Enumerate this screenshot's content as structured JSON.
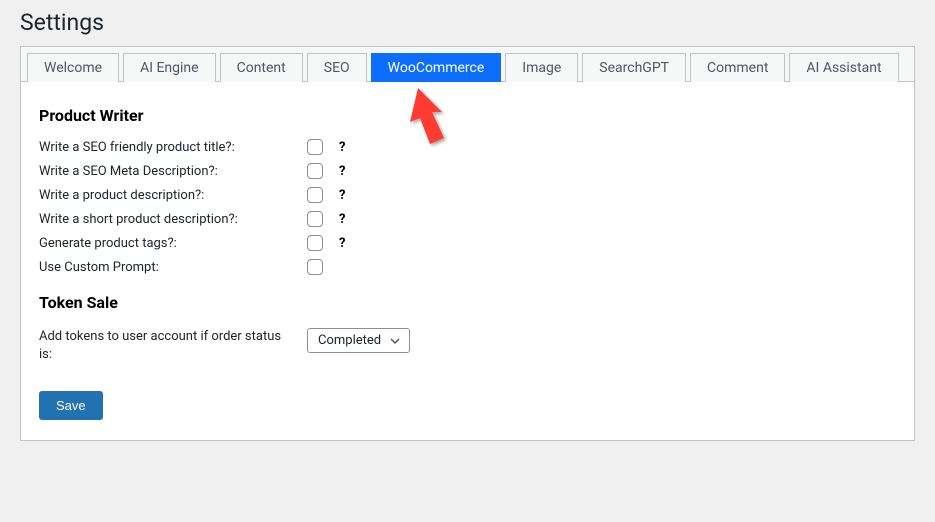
{
  "page": {
    "title": "Settings"
  },
  "tabs": [
    {
      "label": "Welcome",
      "active": false
    },
    {
      "label": "AI Engine",
      "active": false
    },
    {
      "label": "Content",
      "active": false
    },
    {
      "label": "SEO",
      "active": false
    },
    {
      "label": "WooCommerce",
      "active": true
    },
    {
      "label": "Image",
      "active": false
    },
    {
      "label": "SearchGPT",
      "active": false
    },
    {
      "label": "Comment",
      "active": false
    },
    {
      "label": "AI Assistant",
      "active": false
    }
  ],
  "sections": {
    "product_writer": {
      "heading": "Product Writer",
      "rows": [
        {
          "label": "Write a SEO friendly product title?:",
          "checked": false,
          "help": "?"
        },
        {
          "label": "Write a SEO Meta Description?:",
          "checked": false,
          "help": "?"
        },
        {
          "label": "Write a product description?:",
          "checked": false,
          "help": "?"
        },
        {
          "label": "Write a short product description?:",
          "checked": false,
          "help": "?"
        },
        {
          "label": "Generate product tags?:",
          "checked": false,
          "help": "?"
        },
        {
          "label": "Use Custom Prompt:",
          "checked": false,
          "help": ""
        }
      ]
    },
    "token_sale": {
      "heading": "Token Sale",
      "label": "Add tokens to user account if order status is:",
      "select": {
        "value": "Completed"
      }
    }
  },
  "buttons": {
    "save": "Save"
  },
  "annotation": {
    "arrow_color": "#ff3b30"
  }
}
